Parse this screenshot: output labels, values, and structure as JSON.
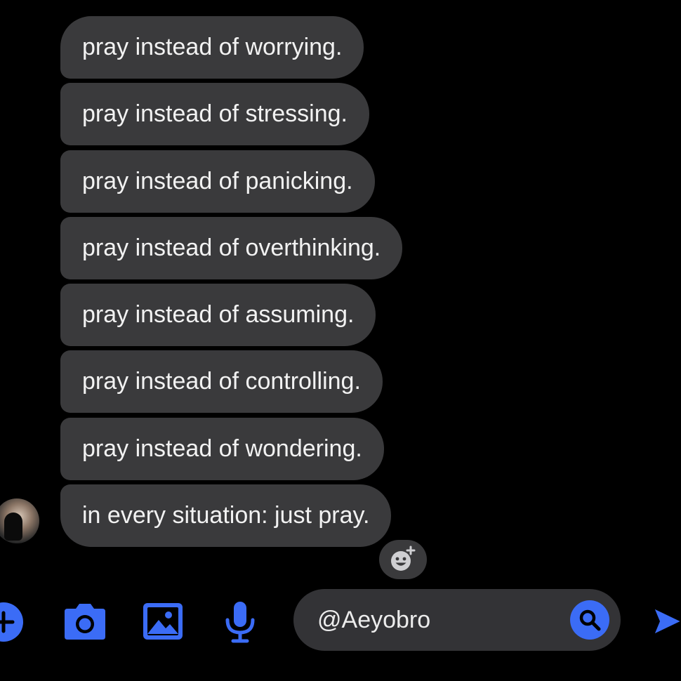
{
  "messages": [
    "pray instead of worrying.",
    "pray instead of stressing.",
    "pray instead of panicking.",
    "pray instead of overthinking.",
    "pray instead of assuming.",
    "pray instead of controlling.",
    "pray instead of wondering.",
    "in every situation: just pray."
  ],
  "composer": {
    "input_value": "@Aeyobro"
  },
  "icons": {
    "add": "plus-circle-icon",
    "camera": "camera-icon",
    "gallery": "image-icon",
    "mic": "microphone-icon",
    "search": "search-icon",
    "send": "send-icon",
    "react": "add-reaction-icon"
  },
  "colors": {
    "background": "#000000",
    "bubble": "#3a3a3c",
    "accent": "#3b6cf6",
    "input_bg": "#333336"
  }
}
